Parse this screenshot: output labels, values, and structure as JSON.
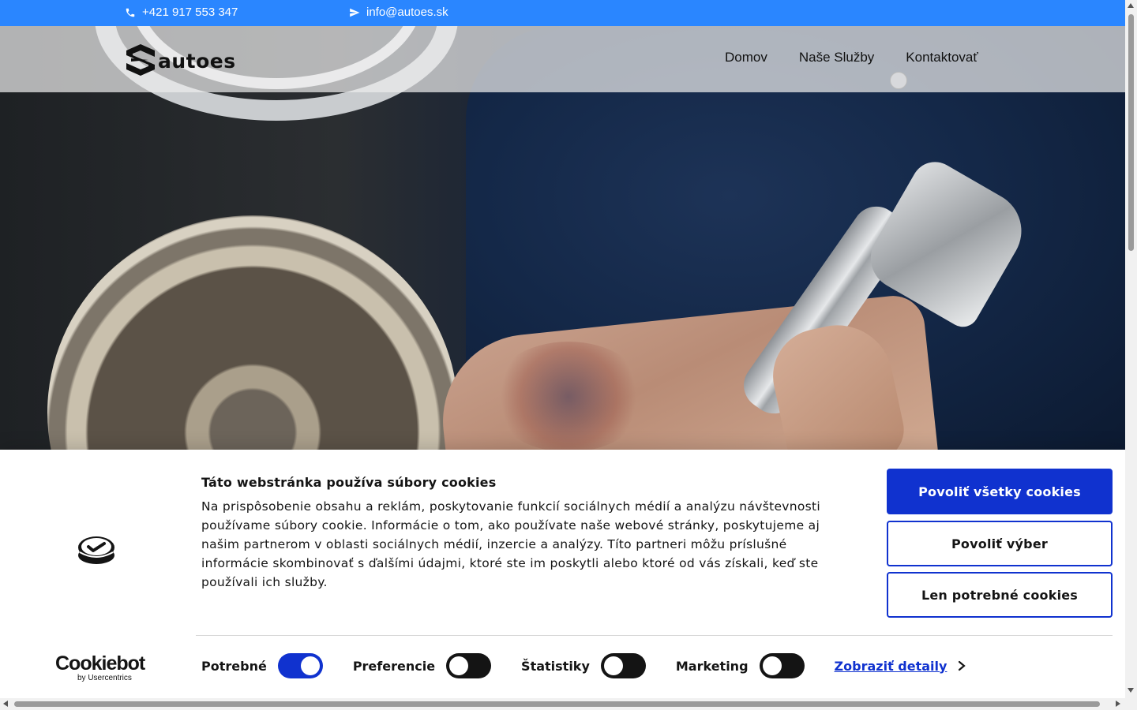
{
  "topbar": {
    "phone": "+421 917 553 347",
    "email": "info@autoes.sk",
    "bg_color": "#2a86ff"
  },
  "header": {
    "logo_text": "autoes",
    "nav": [
      {
        "label": "Domov"
      },
      {
        "label": "Naše Služby"
      },
      {
        "label": "Kontaktovať"
      }
    ]
  },
  "cookie_banner": {
    "title": "Táto webstránka používa súbory cookies",
    "text": "Na prispôsobenie obsahu a reklám, poskytovanie funkcií sociálnych médií a analýzu návštevnosti používame súbory cookie. Informácie o tom, ako používate naše webové stránky, poskytujeme aj našim partnerom v oblasti sociálnych médií, inzercie a analýzy. Títo partneri môžu príslušné informácie skombinovať s ďalšími údajmi, ktoré ste im poskytli alebo ktoré od vás získali, keď ste používali ich služby.",
    "buttons": {
      "allow_all": "Povoliť všetky cookies",
      "allow_selection": "Povoliť výber",
      "necessary_only": "Len potrebné cookies"
    },
    "toggles": [
      {
        "label": "Potrebné",
        "on": true
      },
      {
        "label": "Preferencie",
        "on": false
      },
      {
        "label": "Štatistiky",
        "on": false
      },
      {
        "label": "Marketing",
        "on": false
      }
    ],
    "details_link": "Zobraziť detaily",
    "brand": "Cookiebot",
    "brand_sub": "by Usercentrics",
    "accent_color": "#1032cf"
  }
}
